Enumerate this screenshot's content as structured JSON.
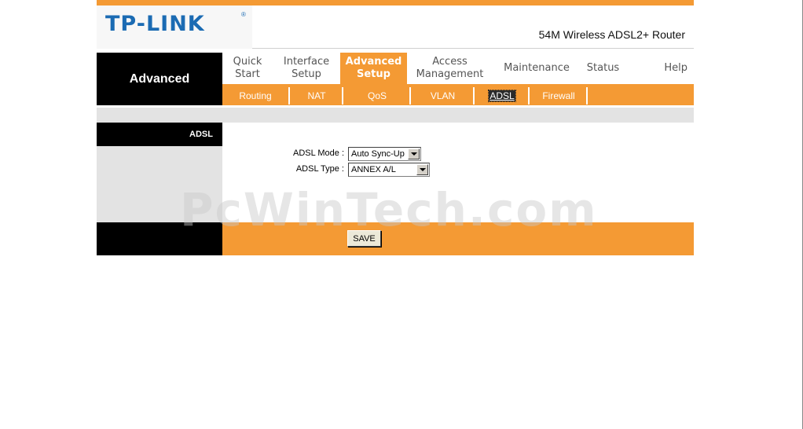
{
  "brand": {
    "logo": "TP-LINK",
    "registered": "®",
    "product": "54M Wireless ADSL2+ Router"
  },
  "nav": {
    "section_title": "Advanced",
    "tabs": [
      {
        "line1": "Quick",
        "line2": "Start"
      },
      {
        "line1": "Interface",
        "line2": "Setup"
      },
      {
        "line1": "Advanced",
        "line2": "Setup"
      },
      {
        "line1": "Access",
        "line2": "Management"
      },
      {
        "line1": "Maintenance",
        "line2": ""
      },
      {
        "line1": "Status",
        "line2": ""
      },
      {
        "line1": "Help",
        "line2": ""
      }
    ],
    "subtabs": [
      "Routing",
      "NAT",
      "QoS",
      "VLAN",
      "ADSL",
      "Firewall"
    ]
  },
  "panel": {
    "title": "ADSL"
  },
  "form": {
    "mode_label": "ADSL Mode :",
    "mode_value": "Auto Sync-Up",
    "type_label": "ADSL Type :",
    "type_value": "ANNEX A/L"
  },
  "actions": {
    "save_label": "SAVE"
  },
  "watermark": "PcWinTech.com",
  "colors": {
    "accent": "#f49a34",
    "logo": "#1b6bb3",
    "dark": "#000000",
    "panel": "#e3e3e3"
  }
}
